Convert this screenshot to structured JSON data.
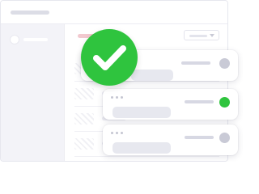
{
  "colors": {
    "success_green": "#2fc43e",
    "status_idle": "#c9cad6",
    "status_active": "#2fc43e"
  },
  "badge": {
    "icon": "checkmark-icon",
    "state": "success"
  },
  "cards": [
    {
      "status": "idle"
    },
    {
      "status": "active"
    },
    {
      "status": "idle"
    }
  ],
  "header": {
    "dropdown_icon": "chevron-down-icon"
  }
}
